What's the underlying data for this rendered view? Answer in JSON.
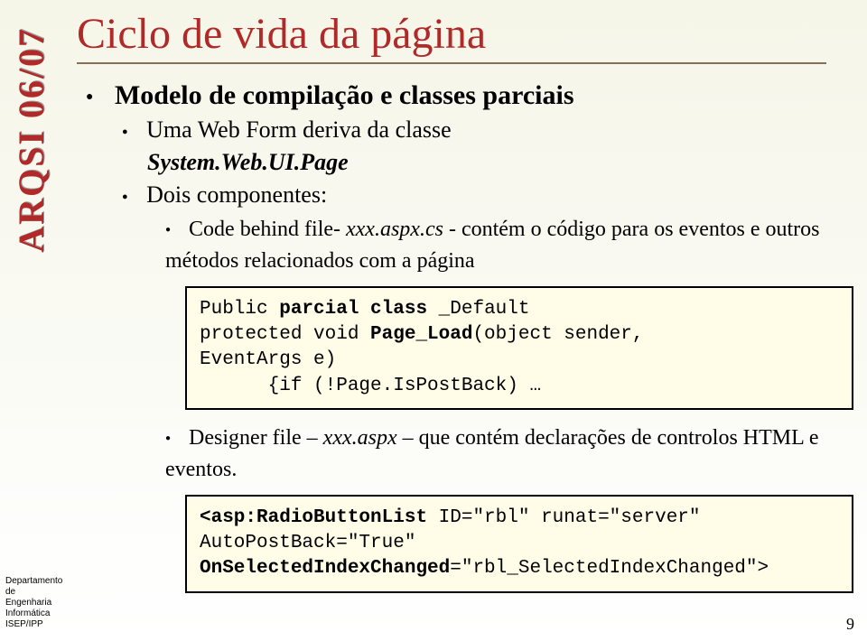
{
  "sidebar": {
    "vertical_text": "ARQSI 06/07",
    "footer_lines": [
      "Departamento de",
      "Engenharia Informática",
      "ISEP/IPP"
    ]
  },
  "title": "Ciclo de vida da página",
  "bullets": {
    "b1": "Modelo de compilação e classes parciais",
    "b2": "Uma Web Form deriva da classe",
    "b2_sub": "System.Web.UI.Page",
    "b3": "Dois componentes:",
    "b4_prefix": "Code behind file- ",
    "b4_italic": "xxx.aspx.cs",
    "b4_suffix": " - contém o código para os eventos e outros métodos relacionados com a página",
    "b5_prefix": "Designer file – ",
    "b5_italic": "xxx.aspx",
    "b5_suffix": " – que contém declarações  de controlos HTML e eventos."
  },
  "code1": {
    "l1a": "Public ",
    "l1b": "parcial class ",
    "l1c": "_Default",
    "l2a": "protected void ",
    "l2b": "Page_Load",
    "l2c": "(object sender,",
    "l3": "EventArgs e)",
    "l4": "      {if (!Page.IsPostBack) …"
  },
  "code2": {
    "l1a": "<asp:RadioButtonList",
    "l1b": " ID=\"rbl\" runat=\"server\"",
    "l2": "AutoPostBack=\"True\"",
    "l3a": "OnSelectedIndexChanged",
    "l3b": "=\"rbl_SelectedIndexChanged\">"
  },
  "page_number": "9"
}
